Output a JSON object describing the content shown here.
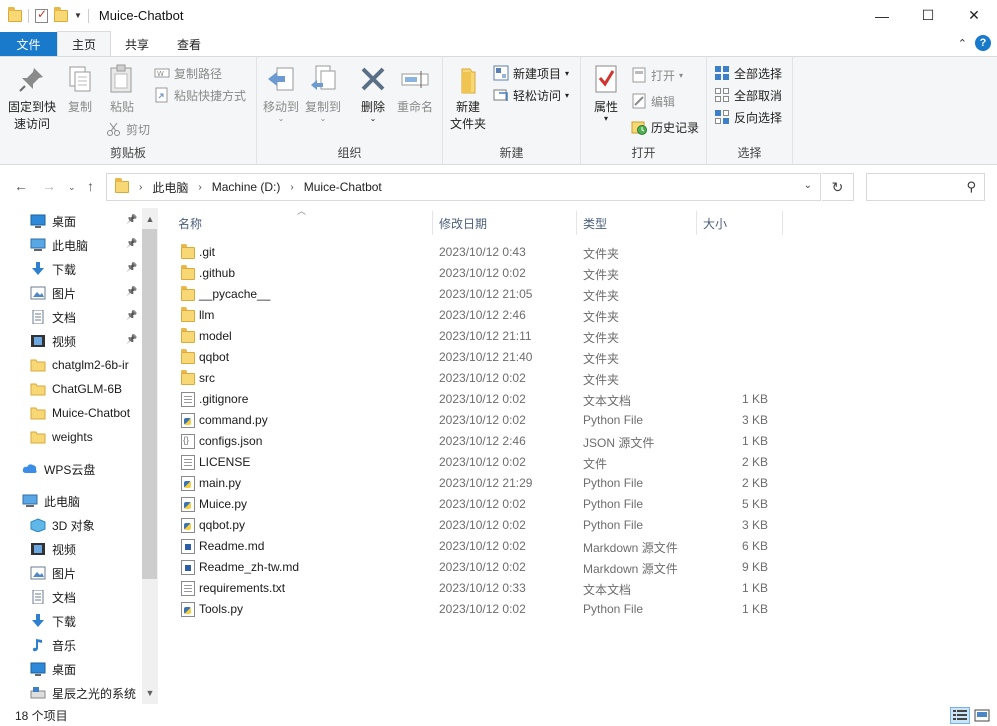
{
  "window": {
    "title": "Muice-Chatbot",
    "controls": [
      "—",
      "☐",
      "✕"
    ]
  },
  "ribbon_tabs": {
    "file": "文件",
    "home": "主页",
    "share": "共享",
    "view": "查看"
  },
  "ribbon": {
    "clipboard": {
      "label": "剪贴板",
      "pin": "固定到快\n速访问",
      "pin_line1": "固定到快",
      "pin_line2": "速访问",
      "copy": "复制",
      "paste": "粘贴",
      "copy_path": "复制路径",
      "paste_shortcut": "粘贴快捷方式",
      "cut": "剪切"
    },
    "organize": {
      "label": "组织",
      "move_to": "移动到",
      "copy_to": "复制到",
      "delete": "删除",
      "rename": "重命名"
    },
    "new": {
      "label": "新建",
      "new_folder_line1": "新建",
      "new_folder_line2": "文件夹",
      "new_item": "新建项目",
      "easy_access": "轻松访问"
    },
    "open": {
      "label": "打开",
      "properties": "属性",
      "open": "打开",
      "edit": "编辑",
      "history": "历史记录"
    },
    "select": {
      "label": "选择",
      "select_all": "全部选择",
      "select_none": "全部取消",
      "invert": "反向选择"
    }
  },
  "address": {
    "crumbs": [
      "此电脑",
      "Machine (D:)",
      "Muice-Chatbot"
    ]
  },
  "nav": {
    "items": [
      {
        "label": "桌面",
        "icon": "desktop-icon",
        "pinned": true
      },
      {
        "label": "此电脑",
        "icon": "pc-icon",
        "pinned": true
      },
      {
        "label": "下载",
        "icon": "download-icon",
        "pinned": true
      },
      {
        "label": "图片",
        "icon": "pictures-icon",
        "pinned": true
      },
      {
        "label": "文档",
        "icon": "documents-icon",
        "pinned": true
      },
      {
        "label": "视频",
        "icon": "videos-icon",
        "pinned": true
      },
      {
        "label": "chatglm2-6b-ir",
        "icon": "folder-icon",
        "pinned": false
      },
      {
        "label": "ChatGLM-6B",
        "icon": "folder-icon",
        "pinned": false
      },
      {
        "label": "Muice-Chatbot",
        "icon": "folder-icon",
        "pinned": false
      },
      {
        "label": "weights",
        "icon": "folder-icon",
        "pinned": false
      },
      {
        "label": "WPS云盘",
        "icon": "cloud-icon",
        "pinned": false
      },
      {
        "label": "此电脑",
        "icon": "pc-icon",
        "pinned": false
      },
      {
        "label": "3D 对象",
        "icon": "3d-objects-icon",
        "pinned": false
      },
      {
        "label": "视频",
        "icon": "videos-icon",
        "pinned": false
      },
      {
        "label": "图片",
        "icon": "pictures-icon",
        "pinned": false
      },
      {
        "label": "文档",
        "icon": "documents-icon",
        "pinned": false
      },
      {
        "label": "下载",
        "icon": "download-icon",
        "pinned": false
      },
      {
        "label": "音乐",
        "icon": "music-icon",
        "pinned": false
      },
      {
        "label": "桌面",
        "icon": "desktop-icon",
        "pinned": false
      },
      {
        "label": "星辰之光的系统",
        "icon": "drive-icon",
        "pinned": false
      }
    ]
  },
  "columns": {
    "name": "名称",
    "date": "修改日期",
    "type": "类型",
    "size": "大小"
  },
  "files": [
    {
      "name": ".git",
      "date": "2023/10/12 0:43",
      "type": "文件夹",
      "size": "",
      "kind": "folder"
    },
    {
      "name": ".github",
      "date": "2023/10/12 0:02",
      "type": "文件夹",
      "size": "",
      "kind": "folder"
    },
    {
      "name": "__pycache__",
      "date": "2023/10/12 21:05",
      "type": "文件夹",
      "size": "",
      "kind": "folder"
    },
    {
      "name": "llm",
      "date": "2023/10/12 2:46",
      "type": "文件夹",
      "size": "",
      "kind": "folder"
    },
    {
      "name": "model",
      "date": "2023/10/12 21:11",
      "type": "文件夹",
      "size": "",
      "kind": "folder"
    },
    {
      "name": "qqbot",
      "date": "2023/10/12 21:40",
      "type": "文件夹",
      "size": "",
      "kind": "folder"
    },
    {
      "name": "src",
      "date": "2023/10/12 0:02",
      "type": "文件夹",
      "size": "",
      "kind": "folder"
    },
    {
      "name": ".gitignore",
      "date": "2023/10/12 0:02",
      "type": "文本文档",
      "size": "1 KB",
      "kind": "doc"
    },
    {
      "name": "command.py",
      "date": "2023/10/12 0:02",
      "type": "Python File",
      "size": "3 KB",
      "kind": "py"
    },
    {
      "name": "configs.json",
      "date": "2023/10/12 2:46",
      "type": "JSON 源文件",
      "size": "1 KB",
      "kind": "json"
    },
    {
      "name": "LICENSE",
      "date": "2023/10/12 0:02",
      "type": "文件",
      "size": "2 KB",
      "kind": "doc"
    },
    {
      "name": "main.py",
      "date": "2023/10/12 21:29",
      "type": "Python File",
      "size": "2 KB",
      "kind": "py"
    },
    {
      "name": "Muice.py",
      "date": "2023/10/12 0:02",
      "type": "Python File",
      "size": "5 KB",
      "kind": "py"
    },
    {
      "name": "qqbot.py",
      "date": "2023/10/12 0:02",
      "type": "Python File",
      "size": "3 KB",
      "kind": "py"
    },
    {
      "name": "Readme.md",
      "date": "2023/10/12 0:02",
      "type": "Markdown 源文件",
      "size": "6 KB",
      "kind": "md"
    },
    {
      "name": "Readme_zh-tw.md",
      "date": "2023/10/12 0:02",
      "type": "Markdown 源文件",
      "size": "9 KB",
      "kind": "md"
    },
    {
      "name": "requirements.txt",
      "date": "2023/10/12 0:33",
      "type": "文本文档",
      "size": "1 KB",
      "kind": "doc"
    },
    {
      "name": "Tools.py",
      "date": "2023/10/12 0:02",
      "type": "Python File",
      "size": "1 KB",
      "kind": "py"
    }
  ],
  "status": {
    "item_count": "18 个项目"
  },
  "colors": {
    "accent": "#1979ca",
    "folder": "#f8d775"
  }
}
